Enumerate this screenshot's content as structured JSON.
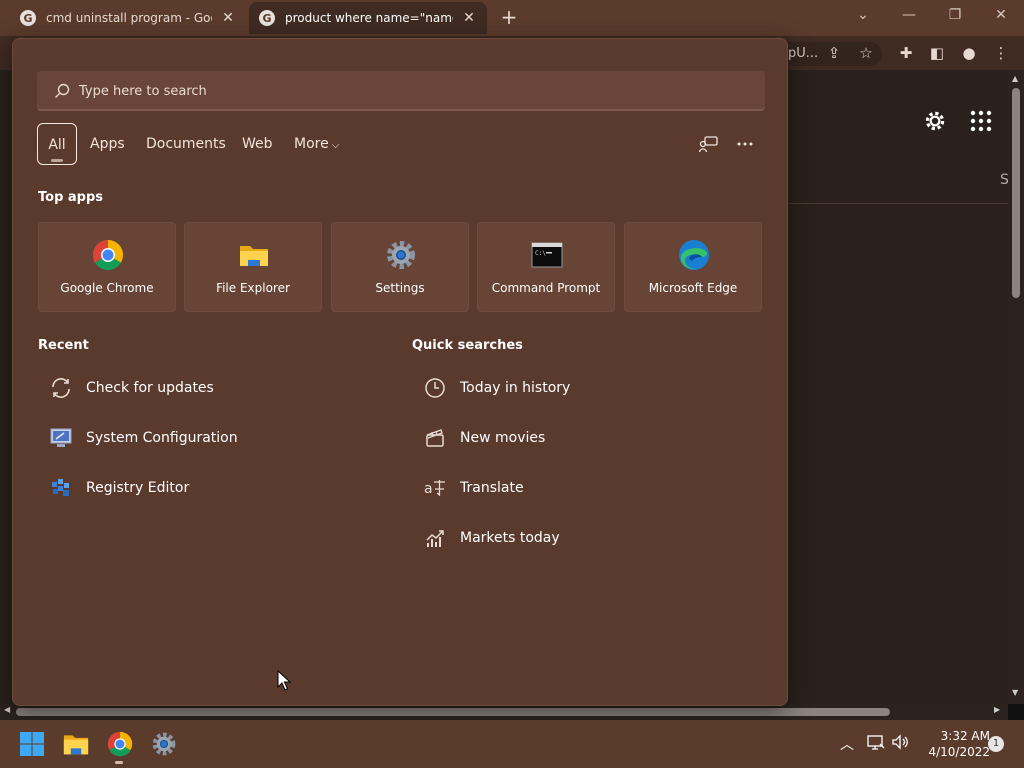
{
  "browser": {
    "tabs": [
      {
        "title": "cmd uninstall program - Google"
      },
      {
        "title": "product where name=\"name of p"
      }
    ],
    "address_suffix": "pU..."
  },
  "page": {
    "partial_text": "S"
  },
  "search": {
    "placeholder": "Type here to search",
    "filters": [
      {
        "label": "All",
        "active": true
      },
      {
        "label": "Apps"
      },
      {
        "label": "Documents"
      },
      {
        "label": "Web"
      },
      {
        "label": "More"
      }
    ]
  },
  "top_apps": {
    "title": "Top apps",
    "items": [
      {
        "label": "Google Chrome",
        "icon": "chrome-icon"
      },
      {
        "label": "File Explorer",
        "icon": "folder-icon"
      },
      {
        "label": "Settings",
        "icon": "settings-gear-icon"
      },
      {
        "label": "Command Prompt",
        "icon": "terminal-icon"
      },
      {
        "label": "Microsoft Edge",
        "icon": "edge-icon"
      }
    ]
  },
  "recent": {
    "title": "Recent",
    "items": [
      {
        "label": "Check for updates",
        "icon": "refresh-icon"
      },
      {
        "label": "System Configuration",
        "icon": "system-config-icon"
      },
      {
        "label": "Registry Editor",
        "icon": "registry-icon"
      }
    ]
  },
  "quick_searches": {
    "title": "Quick searches",
    "items": [
      {
        "label": "Today in history",
        "icon": "clock-icon"
      },
      {
        "label": "New movies",
        "icon": "clapperboard-icon"
      },
      {
        "label": "Translate",
        "icon": "translate-icon"
      },
      {
        "label": "Markets today",
        "icon": "chart-icon"
      }
    ]
  },
  "taskbar": {
    "time": "3:32 AM",
    "date": "4/10/2022",
    "notification_count": "1"
  },
  "colors": {
    "accent": "#5b3a2e",
    "taskbar": "#5a3b2c",
    "tile": "#674436"
  }
}
